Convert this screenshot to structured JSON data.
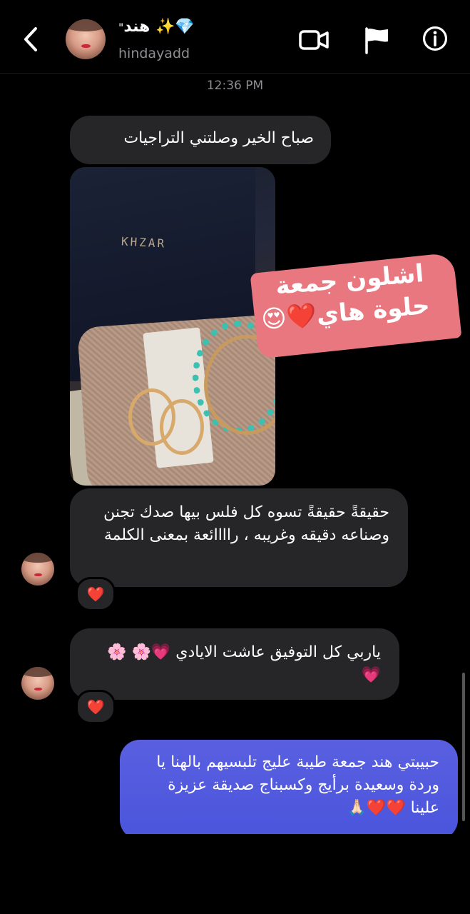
{
  "header": {
    "display_name": "💎✨ هند",
    "name_suffix": "\"",
    "username": "hindayadd"
  },
  "timestamp": "12:36 PM",
  "messages": {
    "m1": "صباح الخير وصلتني التراجيات",
    "photo_logo": "KHZAR",
    "sticker_line1": "اشلون جمعة",
    "sticker_line2": "حلوة هاي❤️😍",
    "m2": "حقيقةً حقيقةً تسوه كل فلس بيها صدك تجنن وصناعه دقيقه وغريبه ، راااائعة بمعنى الكلمة",
    "m2_reaction": "❤️",
    "m3": "ياربي كل التوفيق عاشت الايادي 💗🌸 🌸💗",
    "m3_reaction": "❤️",
    "m4": "حبيبتي هند جمعة طيبة عليج تلبسيهم بالهنا يا وردة وسعيدة برأيج وكسبناج صديقة عزيزة علينا ❤️❤️🙏🏻"
  },
  "icons": {
    "back": "chevron-left-icon",
    "video": "video-camera-icon",
    "flag": "flag-icon",
    "info": "info-icon"
  },
  "colors": {
    "background": "#000000",
    "received_bubble": "#262628",
    "sent_bubble": "#4f57de",
    "sticker": "#e8777f",
    "muted_text": "#8e8e93"
  }
}
